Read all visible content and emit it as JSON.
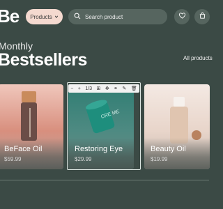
{
  "header": {
    "logo": "Be",
    "products_label": "Products",
    "search_placeholder": "Search product"
  },
  "headings": {
    "eyebrow": "Monthly",
    "title": "Bestsellers",
    "all_products": "All products"
  },
  "toolbar": {
    "count_label": "1/3"
  },
  "products": [
    {
      "name": "BeFace Oil",
      "price": "$59.99"
    },
    {
      "name": "Restoring Eye",
      "price": "$29.99"
    },
    {
      "name": "Beauty Oil",
      "price": "$19.99"
    }
  ],
  "product2_jar_label": "CRE ME"
}
